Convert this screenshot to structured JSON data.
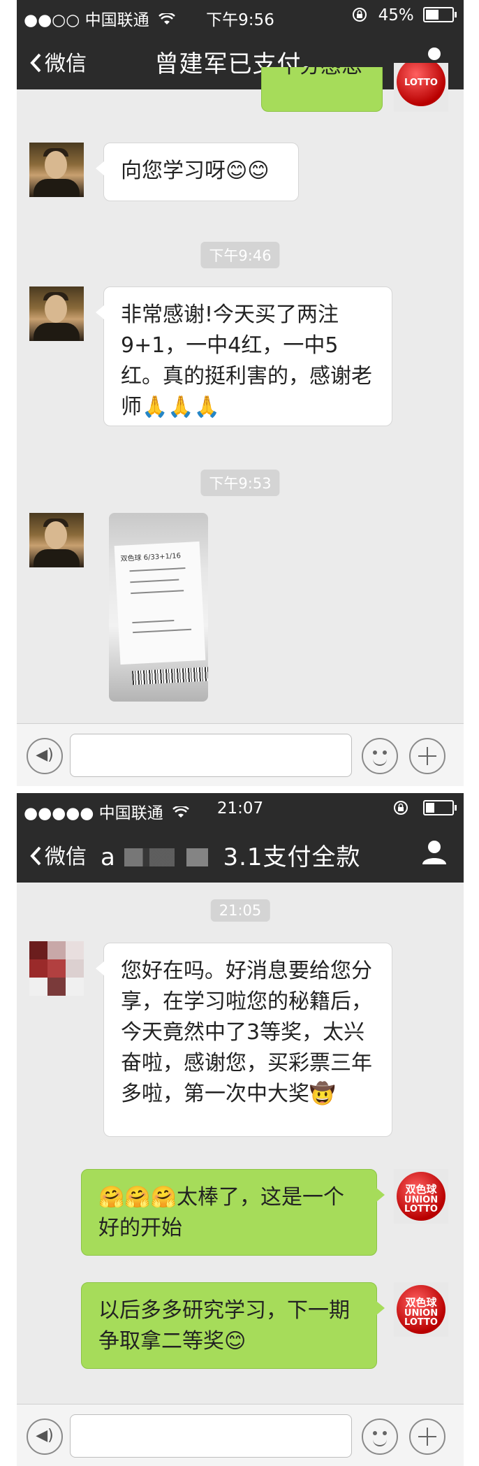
{
  "screen1": {
    "status": {
      "carrier": "●●○○ 中国联通",
      "time": "下午9:56",
      "battery": "45%"
    },
    "nav": {
      "back_label": "微信",
      "title": "曾建军已支付。"
    },
    "partial_message": "十分感恩",
    "messages": [
      {
        "text": "向您学习呀😊😊"
      },
      {
        "time": "下午9:46"
      },
      {
        "text": "非常感谢!今天买了两注9+1，一中4红，一中5红。真的挺利害的，感谢老师🙏🙏🙏"
      },
      {
        "time": "下午9:53"
      }
    ],
    "ticket_photo": {
      "header": "双色球 6/33+1/16"
    }
  },
  "screen2": {
    "status": {
      "carrier": "●●●●● 中国联通",
      "time": "21:07"
    },
    "nav": {
      "back_label": "微信",
      "title_prefix": "a",
      "title_suffix": "3.1支付全款"
    },
    "time_chip": "21:05",
    "incoming": "您好在吗。好消息要给您分享，在学习啦您的秘籍后，今天竟然中了3等奖，太兴奋啦，感谢您，买彩票三年多啦，第一次中大奖🤠",
    "outgoing": [
      "🤗🤗🤗太棒了，这是一个好的开始",
      "以后多多研究学习，下一期争取拿二等奖😊"
    ]
  },
  "lotto_avatar": {
    "cn": "双色球",
    "en1": "UNION",
    "en2": "LOTTO"
  },
  "colors": {
    "header": "#2b2b2b",
    "chat_bg": "#ebebeb",
    "out_bubble": "#a6dc5a",
    "in_bubble": "#ffffff"
  }
}
